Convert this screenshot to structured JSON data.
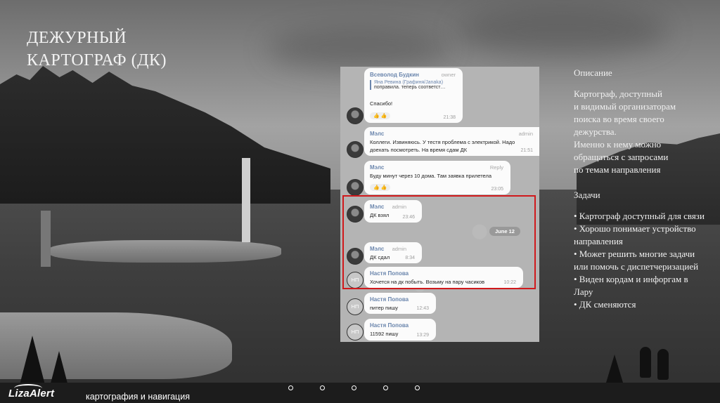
{
  "slide": {
    "title_lines": [
      "ДЕЖУРНЫЙ",
      "КАРТОГРАФ (ДК)"
    ]
  },
  "chat": {
    "messages": [
      {
        "sender": "Всеволод Будкин",
        "role": "owner",
        "quote_author": "Яна Ревина (Графиня/Janaka)",
        "quote_text": "поправила. теперь соответст…",
        "text": [
          "Спасибо!"
        ],
        "reactions": "👍 👍",
        "time": "21:38"
      },
      {
        "sender": "Мэлс",
        "role": "admin",
        "text": [
          "Коллеги. Извиняюсь. У тестя проблема с электрикой. Надо",
          "доехать посмотреть. На время сдам ДК"
        ],
        "time": "21:51"
      },
      {
        "sender": "Мэлс",
        "role": "Reply",
        "text": [
          "Буду минут через 10 дома. Там заявка прилетела"
        ],
        "reactions": "👍 👍",
        "time": "23:05"
      },
      {
        "sender": "Мэлс",
        "role": "admin",
        "text": [
          "ДК взял"
        ],
        "time": "23:46"
      },
      {
        "sender": "Мэлс",
        "role": "admin",
        "text": [
          "ДК сдал"
        ],
        "time": "8:34"
      },
      {
        "sender": "Настя Попова",
        "role": "",
        "text": [
          "Хочется на дк побыть. Возьму на пару часиков"
        ],
        "time": "10:22"
      },
      {
        "sender": "Настя Попова",
        "role": "",
        "text": [
          "питер пишу"
        ],
        "time": "12:43"
      },
      {
        "sender": "Настя Попова",
        "role": "",
        "text": [
          "11592 пишу"
        ],
        "time": "13:29"
      }
    ],
    "date_separator": "June 12",
    "avatar_initials": "НП"
  },
  "description": {
    "heading": "Описание",
    "text": "Картограф, доступный\nи видимый организаторам\nпоиска во время своего\nдежурства.\nИменно к нему можно\nобращаться с запросами\nпо темам направления",
    "tasks_heading": "Задачи",
    "tasks": [
      "•  Картограф доступный для связи",
      "• Хорошо понимает устройство направления",
      "• Может решить многие задачи или помочь с диспетчеризацией",
      "•  Виден кордам и инфоргам в Лару",
      "•  ДК сменяются"
    ]
  },
  "footer": {
    "logo": "LizaAlert",
    "text": "картография и навигация",
    "pager_count": 5
  },
  "colors": {
    "highlight": "#d0191c",
    "sender": "#6b86ad",
    "bottom_bar": "#1c1c1c"
  }
}
